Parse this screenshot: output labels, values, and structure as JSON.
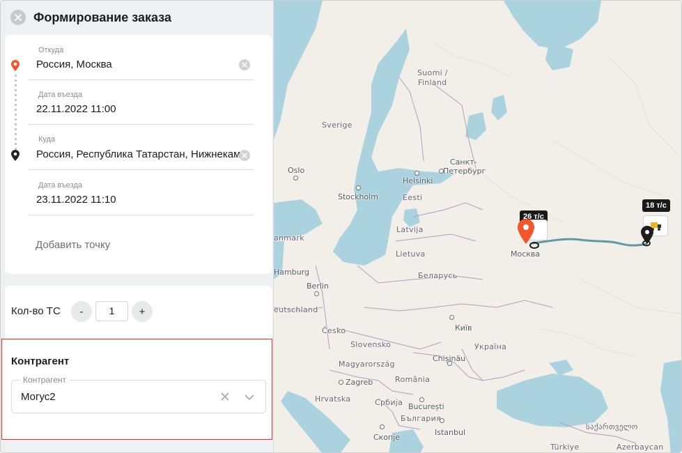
{
  "header": {
    "title": "Формирование заказа"
  },
  "route": {
    "from": {
      "label": "Откуда",
      "value": "Россия, Москва"
    },
    "from_date": {
      "label": "Дата въезда",
      "value": "22.11.2022 11:00"
    },
    "to": {
      "label": "Куда",
      "value": "Россия, Республика Татарстан, Нижнекамск"
    },
    "to_date": {
      "label": "Дата въезда",
      "value": "23.11.2022 11:10"
    },
    "add_point": "Добавить точку"
  },
  "vehicles": {
    "label": "Кол-во ТС",
    "minus": "-",
    "plus": "+",
    "value": "1"
  },
  "contractor": {
    "title": "Контрагент",
    "field_label": "Контрагент",
    "value": "Могус2"
  },
  "map": {
    "labels": {
      "suomi": "Suomi /",
      "finland": "Finland",
      "sverige": "Sverige",
      "spb1": "Санкт-",
      "spb2": "Петербург",
      "oslo": "Oslo",
      "helsinki": "Helsinki",
      "stockholm": "Stockholm",
      "eesti": "Eesti",
      "latvija": "Latvija",
      "danmark": "anmark",
      "lietuva": "Lietuva",
      "moskva": "Москва",
      "hamburg": "Hamburg",
      "belarus": "Беларусь",
      "berlin": "Berlin",
      "deutschland": "eutschland",
      "kyiv": "Київ",
      "cesko": "Česko",
      "ukraina": "Україна",
      "slovensko": "Slovensko",
      "chisinau": "Chișinău",
      "magyarorszag": "Magyarország",
      "zagreb": "Zagreb",
      "romania": "România",
      "hrvatska": "Hrvatska",
      "srbija": "Србија",
      "bucuresti": "București",
      "bulgaria": "България",
      "georgia": "საქართველო",
      "istanbul": "Istanbul",
      "skopje": "Скопје",
      "turkiye": "Türkiye",
      "azerbaycan": "Azerbaycan"
    },
    "badge_left": "26 т/с",
    "badge_right": "18 т/с",
    "colors": {
      "water": "#aad3df",
      "land": "#f2efe9",
      "route": "#5e9aa0",
      "pin": "#f2562a"
    }
  }
}
